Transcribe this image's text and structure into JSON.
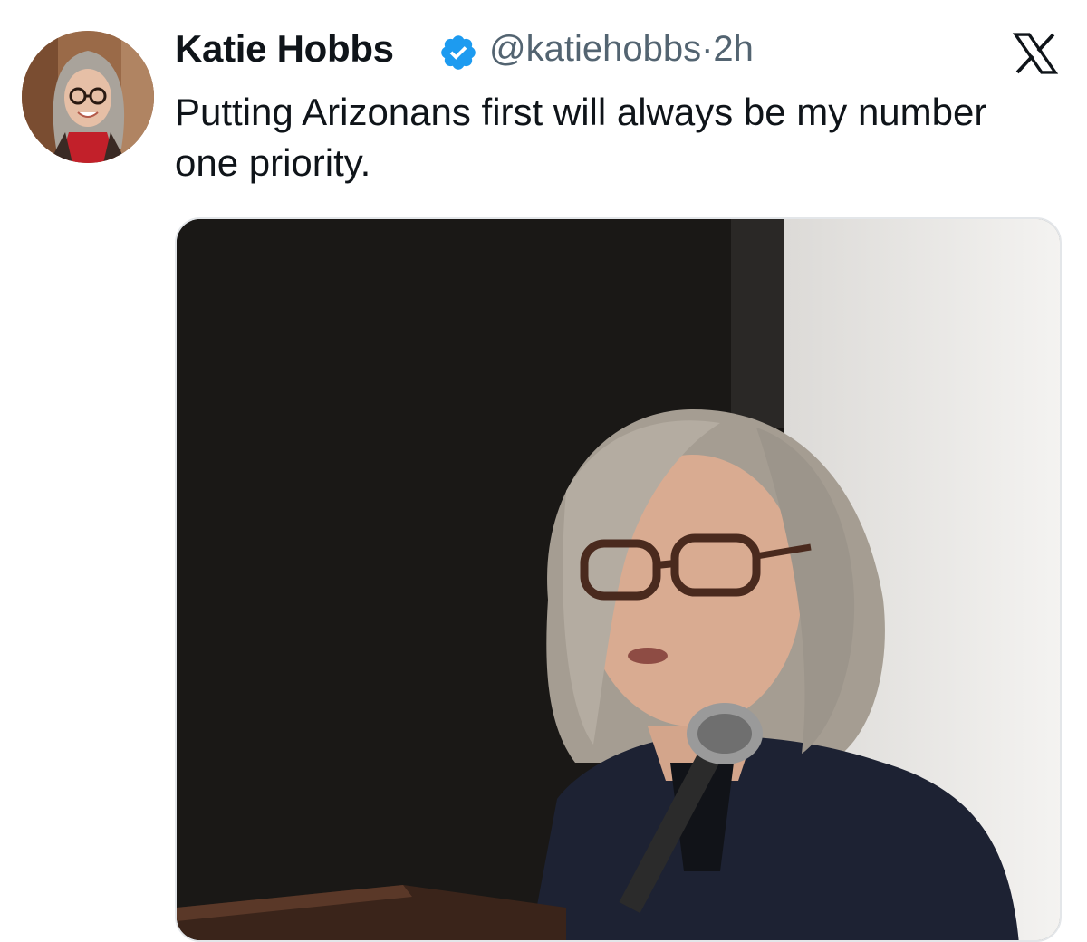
{
  "tweet": {
    "author": {
      "display_name": "Katie Hobbs",
      "handle": "@katiehobbs",
      "verified": true,
      "avatar_icon": "profile-photo"
    },
    "separator": "·",
    "time": "2h",
    "text": "Putting Arizonans first will always be my number one priority.",
    "media": {
      "kind": "video-still",
      "description_icon": "speaker-at-podium-photo"
    }
  },
  "branding": {
    "logo_icon": "x-logo-icon"
  },
  "colors": {
    "verified_blue": "#1d9bf0",
    "handle_gray": "#536471",
    "text": "#0f1419"
  }
}
